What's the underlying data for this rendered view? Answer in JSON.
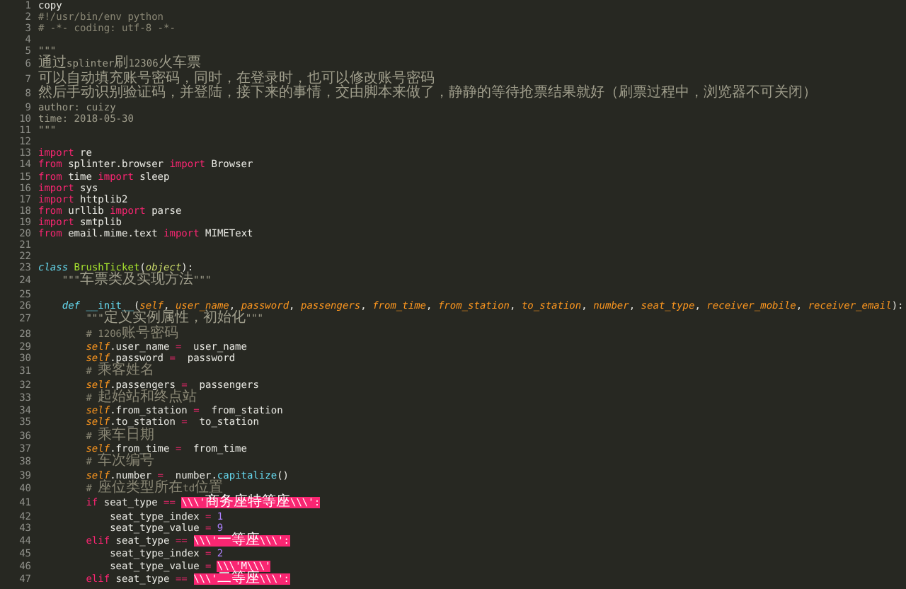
{
  "editor": {
    "lines": [
      {
        "number": "1",
        "tokens": [
          {
            "kind": "plain",
            "text": "copy"
          }
        ]
      },
      {
        "number": "2",
        "tokens": [
          {
            "kind": "comment",
            "text": "#!/usr/bin/env python"
          }
        ]
      },
      {
        "number": "3",
        "tokens": [
          {
            "kind": "comment",
            "text": "# -*- coding: utf-8 -*-"
          }
        ]
      },
      {
        "number": "4"
      },
      {
        "number": "5",
        "tokens": [
          {
            "kind": "string",
            "text": "\"\"\""
          }
        ]
      },
      {
        "number": "6",
        "tokens": [
          {
            "kind": "string",
            "text": "通过splinter刷12306火车票"
          }
        ]
      },
      {
        "number": "7",
        "tokens": [
          {
            "kind": "string",
            "text": "可以自动填充账号密码，同时，在登录时，也可以修改账号密码"
          }
        ]
      },
      {
        "number": "8",
        "tokens": [
          {
            "kind": "string",
            "text": "然后手动识别验证码，并登陆，接下来的事情，交由脚本来做了，静静的等待抢票结果就好（刷票过程中，浏览器不可关闭）"
          }
        ]
      },
      {
        "number": "9",
        "tokens": [
          {
            "kind": "string",
            "text": "author: cuizy"
          }
        ]
      },
      {
        "number": "10",
        "tokens": [
          {
            "kind": "string",
            "text": "time: 2018-05-30"
          }
        ]
      },
      {
        "number": "11",
        "tokens": [
          {
            "kind": "string",
            "text": "\"\"\""
          }
        ]
      },
      {
        "number": "12"
      },
      {
        "number": "13",
        "tokens": [
          {
            "kind": "keyword",
            "text": "import"
          },
          {
            "kind": "plain",
            "text": " re"
          }
        ]
      },
      {
        "number": "14",
        "tokens": [
          {
            "kind": "keyword",
            "text": "from"
          },
          {
            "kind": "plain",
            "text": " splinter.browser "
          },
          {
            "kind": "keyword",
            "text": "import"
          },
          {
            "kind": "plain",
            "text": " Browser"
          }
        ]
      },
      {
        "number": "15",
        "tokens": [
          {
            "kind": "keyword",
            "text": "from"
          },
          {
            "kind": "plain",
            "text": " time "
          },
          {
            "kind": "keyword",
            "text": "import"
          },
          {
            "kind": "plain",
            "text": " sleep"
          }
        ]
      },
      {
        "number": "16",
        "tokens": [
          {
            "kind": "keyword",
            "text": "import"
          },
          {
            "kind": "plain",
            "text": " sys"
          }
        ]
      },
      {
        "number": "17",
        "tokens": [
          {
            "kind": "keyword",
            "text": "import"
          },
          {
            "kind": "plain",
            "text": " httplib2"
          }
        ]
      },
      {
        "number": "18",
        "tokens": [
          {
            "kind": "keyword",
            "text": "from"
          },
          {
            "kind": "plain",
            "text": " urllib "
          },
          {
            "kind": "keyword",
            "text": "import"
          },
          {
            "kind": "plain",
            "text": " parse"
          }
        ]
      },
      {
        "number": "19",
        "tokens": [
          {
            "kind": "keyword",
            "text": "import"
          },
          {
            "kind": "plain",
            "text": " smtplib"
          }
        ]
      },
      {
        "number": "20",
        "tokens": [
          {
            "kind": "keyword",
            "text": "from"
          },
          {
            "kind": "plain",
            "text": " email.mime.text "
          },
          {
            "kind": "keyword",
            "text": "import"
          },
          {
            "kind": "plain",
            "text": " MIMEText"
          }
        ]
      },
      {
        "number": "21"
      },
      {
        "number": "22"
      },
      {
        "number": "23",
        "tokens": [
          {
            "kind": "storage",
            "text": "class "
          },
          {
            "kind": "class",
            "text": "BrushTicket"
          },
          {
            "kind": "plain",
            "text": "("
          },
          {
            "kind": "inherit",
            "text": "object"
          },
          {
            "kind": "plain",
            "text": "):"
          }
        ]
      },
      {
        "number": "24",
        "tokens": [
          {
            "kind": "string",
            "text": "    \"\"\"车票类及实现方法\"\"\""
          }
        ]
      },
      {
        "number": "25"
      },
      {
        "number": "26",
        "tokens": [
          {
            "kind": "storage",
            "text": "    def "
          },
          {
            "kind": "function",
            "text": "__init__"
          },
          {
            "kind": "plain",
            "text": "("
          },
          {
            "kind": "param",
            "text": "self"
          },
          {
            "kind": "plain",
            "text": ", "
          },
          {
            "kind": "param",
            "text": "user_name"
          },
          {
            "kind": "plain",
            "text": ", "
          },
          {
            "kind": "param",
            "text": "password"
          },
          {
            "kind": "plain",
            "text": ", "
          },
          {
            "kind": "param",
            "text": "passengers"
          },
          {
            "kind": "plain",
            "text": ", "
          },
          {
            "kind": "param",
            "text": "from_time"
          },
          {
            "kind": "plain",
            "text": ", "
          },
          {
            "kind": "param",
            "text": "from_station"
          },
          {
            "kind": "plain",
            "text": ", "
          },
          {
            "kind": "param",
            "text": "to_station"
          },
          {
            "kind": "plain",
            "text": ", "
          },
          {
            "kind": "param",
            "text": "number"
          },
          {
            "kind": "plain",
            "text": ", "
          },
          {
            "kind": "param",
            "text": "seat_type"
          },
          {
            "kind": "plain",
            "text": ", "
          },
          {
            "kind": "param",
            "text": "receiver_mobile"
          },
          {
            "kind": "plain",
            "text": ", "
          },
          {
            "kind": "param",
            "text": "receiver_email"
          },
          {
            "kind": "plain",
            "text": "):"
          }
        ]
      },
      {
        "number": "27",
        "tokens": [
          {
            "kind": "string",
            "text": "        \"\"\"定义实例属性，初始化\"\"\""
          }
        ]
      },
      {
        "number": "28",
        "tokens": [
          {
            "kind": "comment",
            "text": "        # 1206账号密码"
          }
        ]
      },
      {
        "number": "29",
        "tokens": [
          {
            "kind": "self",
            "text": "        self"
          },
          {
            "kind": "plain",
            "text": ".user_name "
          },
          {
            "kind": "operator",
            "text": "="
          },
          {
            "kind": "plain",
            "text": " user_name"
          }
        ]
      },
      {
        "number": "30",
        "tokens": [
          {
            "kind": "self",
            "text": "        self"
          },
          {
            "kind": "plain",
            "text": ".password "
          },
          {
            "kind": "operator",
            "text": "="
          },
          {
            "kind": "plain",
            "text": " password"
          }
        ]
      },
      {
        "number": "31",
        "tokens": [
          {
            "kind": "comment",
            "text": "        # 乘客姓名"
          }
        ]
      },
      {
        "number": "32",
        "tokens": [
          {
            "kind": "self",
            "text": "        self"
          },
          {
            "kind": "plain",
            "text": ".passengers "
          },
          {
            "kind": "operator",
            "text": "="
          },
          {
            "kind": "plain",
            "text": " passengers"
          }
        ]
      },
      {
        "number": "33",
        "tokens": [
          {
            "kind": "comment",
            "text": "        # 起始站和终点站"
          }
        ]
      },
      {
        "number": "34",
        "tokens": [
          {
            "kind": "self",
            "text": "        self"
          },
          {
            "kind": "plain",
            "text": ".from_station "
          },
          {
            "kind": "operator",
            "text": "="
          },
          {
            "kind": "plain",
            "text": " from_station"
          }
        ]
      },
      {
        "number": "35",
        "tokens": [
          {
            "kind": "self",
            "text": "        self"
          },
          {
            "kind": "plain",
            "text": ".to_station "
          },
          {
            "kind": "operator",
            "text": "="
          },
          {
            "kind": "plain",
            "text": " to_station"
          }
        ]
      },
      {
        "number": "36",
        "tokens": [
          {
            "kind": "comment",
            "text": "        # 乘车日期"
          }
        ]
      },
      {
        "number": "37",
        "tokens": [
          {
            "kind": "self",
            "text": "        self"
          },
          {
            "kind": "plain",
            "text": ".from_time "
          },
          {
            "kind": "operator",
            "text": "="
          },
          {
            "kind": "plain",
            "text": " from_time"
          }
        ]
      },
      {
        "number": "38",
        "tokens": [
          {
            "kind": "comment",
            "text": "        # 车次编号"
          }
        ]
      },
      {
        "number": "39",
        "tokens": [
          {
            "kind": "self",
            "text": "        self"
          },
          {
            "kind": "plain",
            "text": ".number "
          },
          {
            "kind": "operator",
            "text": "="
          },
          {
            "kind": "plain",
            "text": " number."
          },
          {
            "kind": "function",
            "text": "capitalize"
          },
          {
            "kind": "plain",
            "text": "()"
          }
        ]
      },
      {
        "number": "40",
        "tokens": [
          {
            "kind": "comment",
            "text": "        # 座位类型所在td位置"
          }
        ]
      },
      {
        "number": "41",
        "tokens": [
          {
            "kind": "keyword",
            "text": "        if"
          },
          {
            "kind": "plain",
            "text": " seat_type "
          },
          {
            "kind": "operator",
            "text": "=="
          },
          {
            "kind": "highlight",
            "text": "\\\\\\'商务座特等座\\\\\\':"
          }
        ]
      },
      {
        "number": "42",
        "tokens": [
          {
            "kind": "plain",
            "text": "            seat_type_index "
          },
          {
            "kind": "operator",
            "text": "="
          },
          {
            "kind": "number",
            "text": "1"
          }
        ]
      },
      {
        "number": "43",
        "tokens": [
          {
            "kind": "plain",
            "text": "            seat_type_value "
          },
          {
            "kind": "operator",
            "text": "="
          },
          {
            "kind": "number",
            "text": "9"
          }
        ]
      },
      {
        "number": "44",
        "tokens": [
          {
            "kind": "keyword",
            "text": "        elif"
          },
          {
            "kind": "plain",
            "text": " seat_type "
          },
          {
            "kind": "operator",
            "text": "=="
          },
          {
            "kind": "highlight",
            "text": "\\\\\\'一等座\\\\\\':"
          }
        ]
      },
      {
        "number": "45",
        "tokens": [
          {
            "kind": "plain",
            "text": "            seat_type_index "
          },
          {
            "kind": "operator",
            "text": "="
          },
          {
            "kind": "number",
            "text": "2"
          }
        ]
      },
      {
        "number": "46",
        "tokens": [
          {
            "kind": "plain",
            "text": "            seat_type_value "
          },
          {
            "kind": "operator",
            "text": "="
          },
          {
            "kind": "highlight",
            "text": "\\\\\\'M\\\\\\'"
          }
        ]
      },
      {
        "number": "47",
        "tokens": [
          {
            "kind": "keyword",
            "text": "        elif"
          },
          {
            "kind": "plain",
            "text": " seat_type "
          },
          {
            "kind": "operator",
            "text": "=="
          },
          {
            "kind": "highlight",
            "text": "\\\\\\'二等座\\\\\\':"
          }
        ]
      }
    ]
  }
}
